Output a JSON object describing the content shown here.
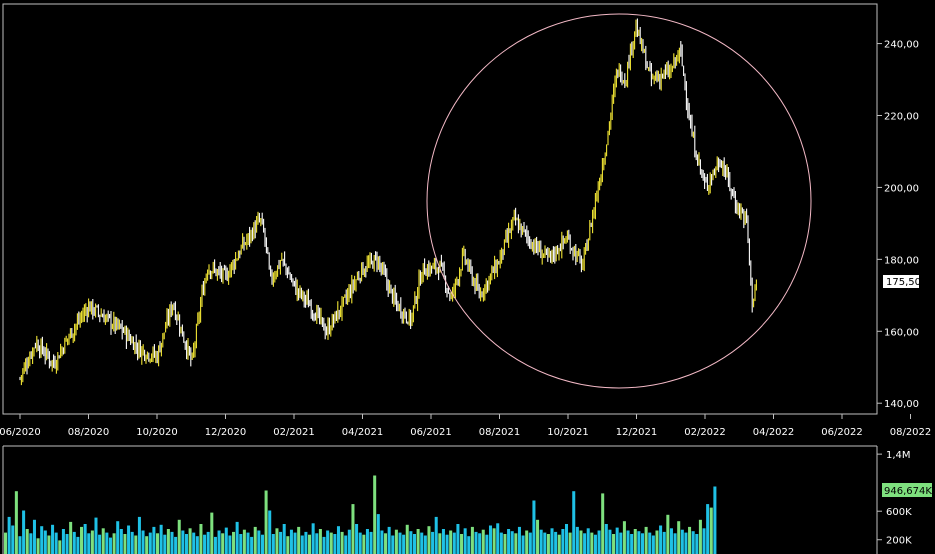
{
  "chart_data": [
    {
      "type": "candlestick",
      "panel": "price",
      "x_ticks": [
        "06/2020",
        "08/2020",
        "10/2020",
        "12/2020",
        "02/2021",
        "04/2021",
        "06/2021",
        "08/2021",
        "10/2021",
        "12/2021",
        "02/2022",
        "04/2022",
        "06/2022",
        "08/2022"
      ],
      "y_ticks": [
        "140,00",
        "160,00",
        "180,00",
        "200,00",
        "220,00",
        "240,00"
      ],
      "ylim": [
        137,
        251
      ],
      "last_value": 175.5,
      "last_value_label": "175,50",
      "colors": {
        "up": "#f2e634",
        "down": "#ffffff",
        "annotation": "#f3b9c6",
        "last_value_box": "#ffffff"
      },
      "series": [
        {
          "x": [
            "2020-06-01",
            "2020-06-15",
            "2020-07-01",
            "2020-07-15",
            "2020-08-01",
            "2020-08-15",
            "2020-09-01",
            "2020-09-15",
            "2020-10-01",
            "2020-10-15",
            "2020-11-01",
            "2020-11-10",
            "2020-11-15",
            "2020-12-01",
            "2020-12-15",
            "2021-01-01",
            "2021-01-05",
            "2021-01-10",
            "2021-01-20",
            "2021-02-01",
            "2021-02-15",
            "2021-03-01",
            "2021-03-15",
            "2021-04-01",
            "2021-04-15",
            "2021-05-01",
            "2021-05-15",
            "2021-05-25",
            "2021-06-10",
            "2021-06-20",
            "2021-07-01",
            "2021-07-15",
            "2021-08-01",
            "2021-08-15",
            "2021-09-01",
            "2021-09-15",
            "2021-10-01",
            "2021-10-15",
            "2021-10-25",
            "2021-11-05",
            "2021-11-15",
            "2021-11-22",
            "2021-12-01",
            "2021-12-15",
            "2022-01-01",
            "2022-01-10",
            "2022-01-20",
            "2022-02-01",
            "2022-02-15",
            "2022-03-01",
            "2022-03-10",
            "2022-03-15",
            "2022-03-20"
          ],
          "y": [
            147,
            157,
            151,
            159,
            167,
            164,
            160,
            155,
            153,
            168,
            151,
            170,
            178,
            175,
            183,
            191,
            186,
            174,
            180,
            172,
            167,
            160,
            167,
            177,
            180,
            168,
            163,
            177,
            178,
            169,
            181,
            170,
            179,
            191,
            184,
            180,
            186,
            178,
            194,
            212,
            233,
            230,
            245,
            230,
            232,
            238,
            215,
            200,
            208,
            195,
            191,
            168,
            175.5
          ]
        }
      ],
      "annotation": "circle"
    },
    {
      "type": "bar",
      "panel": "volume",
      "y_ticks": [
        "200K",
        "600K",
        "1,4M"
      ],
      "ylim": [
        0,
        1500000
      ],
      "last_value_label": "946,674K",
      "colors": {
        "a": "#7ee07e",
        "b": "#1fc1e6",
        "last_value_box": "#7ee07e"
      },
      "values": [
        300000,
        520000,
        400000,
        880000,
        250000,
        610000,
        350000,
        290000,
        480000,
        220000,
        390000,
        330000,
        260000,
        410000,
        300000,
        190000,
        350000,
        280000,
        450000,
        310000,
        240000,
        380000,
        420000,
        290000,
        330000,
        510000,
        270000,
        360000,
        300000,
        230000,
        290000,
        460000,
        350000,
        280000,
        400000,
        310000,
        260000,
        520000,
        330000,
        250000,
        300000,
        380000,
        290000,
        410000,
        270000,
        350000,
        310000,
        240000,
        480000,
        330000,
        280000,
        360000,
        300000,
        250000,
        420000,
        270000,
        310000,
        580000,
        240000,
        330000,
        290000,
        370000,
        260000,
        310000,
        450000,
        280000,
        340000,
        300000,
        240000,
        380000,
        330000,
        270000,
        890000,
        610000,
        280000,
        360000,
        310000,
        420000,
        250000,
        340000,
        300000,
        380000,
        260000,
        310000,
        270000,
        430000,
        290000,
        350000,
        240000,
        330000,
        300000,
        280000,
        390000,
        310000,
        260000,
        340000,
        700000,
        420000,
        300000,
        270000,
        350000,
        310000,
        1100000,
        560000,
        330000,
        290000,
        380000,
        260000,
        340000,
        300000,
        270000,
        410000,
        320000,
        280000,
        350000,
        300000,
        260000,
        390000,
        310000,
        520000,
        290000,
        350000,
        270000,
        330000,
        300000,
        420000,
        280000,
        360000,
        250000,
        380000,
        310000,
        290000,
        340000,
        270000,
        400000,
        360000,
        430000,
        300000,
        280000,
        350000,
        320000,
        290000,
        380000,
        260000,
        330000,
        300000,
        750000,
        480000,
        340000,
        300000,
        280000,
        360000,
        310000,
        270000,
        350000,
        420000,
        300000,
        880000,
        380000,
        330000,
        290000,
        360000,
        300000,
        270000,
        330000,
        850000,
        420000,
        340000,
        280000,
        370000,
        300000,
        460000,
        330000,
        280000,
        350000,
        320000,
        290000,
        380000,
        300000,
        260000,
        330000,
        400000,
        310000,
        550000,
        360000,
        290000,
        460000,
        340000,
        300000,
        380000,
        320000,
        280000,
        480000,
        360000,
        700000,
        650000,
        946674
      ]
    }
  ]
}
